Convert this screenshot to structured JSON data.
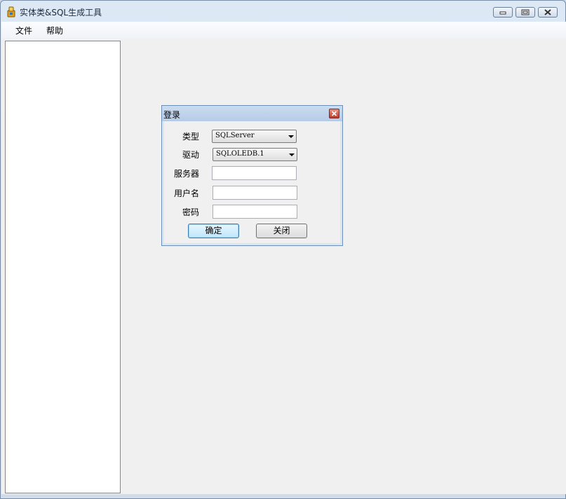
{
  "window": {
    "title": "实体类&SQL生成工具"
  },
  "menu": {
    "items": [
      {
        "label": "文件"
      },
      {
        "label": "帮助"
      }
    ]
  },
  "dialog": {
    "title": "登录",
    "fields": {
      "type_label": "类型",
      "type_value": "SQLServer",
      "driver_label": "驱动",
      "driver_value": "SQLOLEDB.1",
      "server_label": "服务器",
      "server_value": "",
      "username_label": "用户名",
      "username_value": "",
      "password_label": "密码",
      "password_value": ""
    },
    "buttons": {
      "ok_label": "确定",
      "close_label": "关闭"
    }
  },
  "colors": {
    "title_bar": "#dde8f5",
    "client_background": "#f0f0f0",
    "dialog_close": "#c0392b",
    "default_button_border": "#3c7fb1"
  },
  "icons": {
    "app": "app-icon",
    "minimize": "minimize-icon",
    "maximize": "maximize-icon",
    "close": "close-icon",
    "dropdown": "chevron-down-icon"
  }
}
